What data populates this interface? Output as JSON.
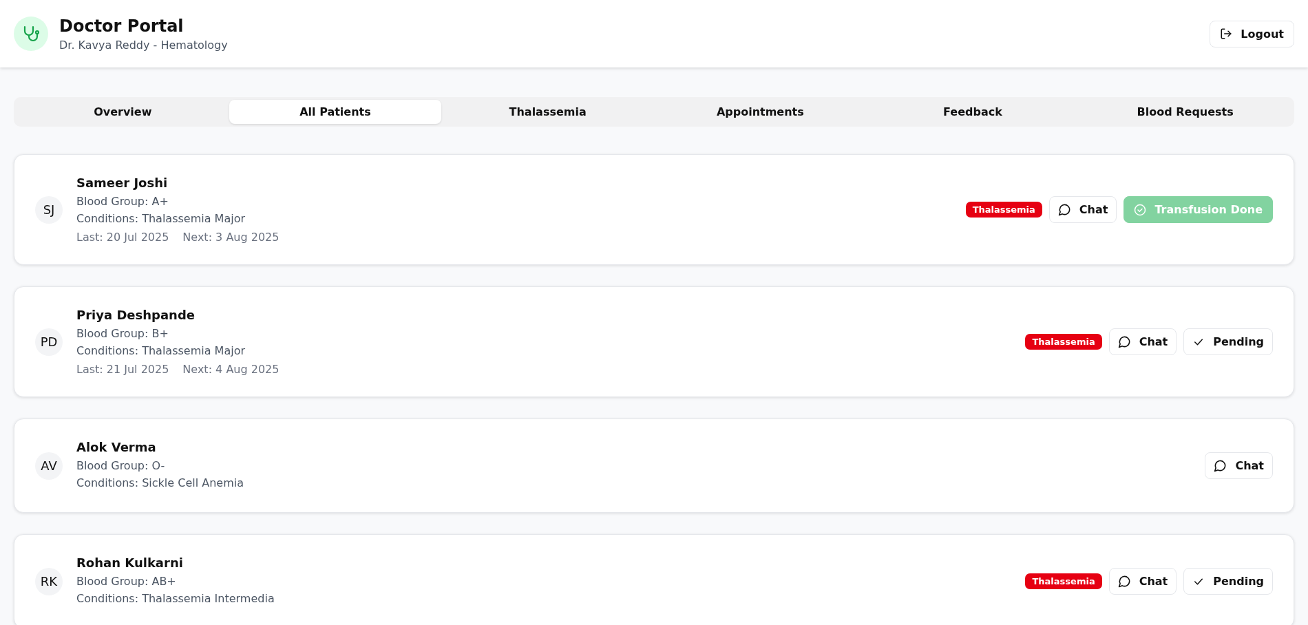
{
  "header": {
    "title": "Doctor Portal",
    "subtitle": "Dr. Kavya Reddy - Hematology",
    "logout": "Logout"
  },
  "tabs": [
    {
      "label": "Overview",
      "selected": false
    },
    {
      "label": "All Patients",
      "selected": true
    },
    {
      "label": "Thalassemia",
      "selected": false
    },
    {
      "label": "Appointments",
      "selected": false
    },
    {
      "label": "Feedback",
      "selected": false
    },
    {
      "label": "Blood Requests",
      "selected": false
    }
  ],
  "patients": [
    {
      "initials": "SJ",
      "name": "Sameer Joshi",
      "blood_group": "Blood Group: A+",
      "conditions": "Conditions: Thalassemia Major",
      "last": "Last: 20 Jul 2025",
      "next": "Next: 3 Aug 2025",
      "tag": "Thalassemia",
      "chat": "Chat",
      "status": {
        "kind": "done",
        "label": "Transfusion Done"
      }
    },
    {
      "initials": "PD",
      "name": "Priya Deshpande",
      "blood_group": "Blood Group: B+",
      "conditions": "Conditions: Thalassemia Major",
      "last": "Last: 21 Jul 2025",
      "next": "Next: 4 Aug 2025",
      "tag": "Thalassemia",
      "chat": "Chat",
      "status": {
        "kind": "pending",
        "label": "Pending"
      }
    },
    {
      "initials": "AV",
      "name": "Alok Verma",
      "blood_group": "Blood Group: O-",
      "conditions": "Conditions: Sickle Cell Anemia",
      "chat": "Chat"
    },
    {
      "initials": "RK",
      "name": "Rohan Kulkarni",
      "blood_group": "Blood Group: AB+",
      "conditions": "Conditions: Thalassemia Intermedia",
      "tag": "Thalassemia",
      "chat": "Chat",
      "status": {
        "kind": "pending",
        "label": "Pending"
      }
    }
  ]
}
